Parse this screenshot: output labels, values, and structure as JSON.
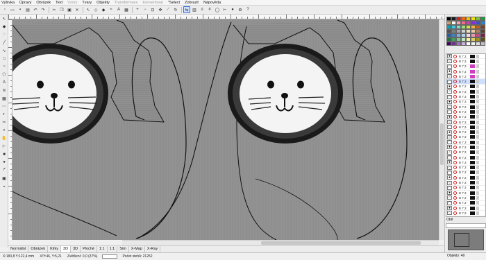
{
  "menu": [
    "Výšivka",
    "Úpravy",
    "Obrázek",
    "Text",
    "Vzory",
    "Tvary",
    "Objekty",
    "Transformace",
    "Konvertovat",
    "\"Select",
    "Zobrazit",
    "Nápověda"
  ],
  "menu_disabled": [
    false,
    false,
    false,
    false,
    true,
    false,
    false,
    true,
    true,
    false,
    false,
    false
  ],
  "toolbar_icons": [
    "new-icon",
    "open-icon",
    "save-icon",
    "print-icon",
    "undo-icon",
    "redo-icon",
    "cut-icon",
    "copy-icon",
    "paste-icon",
    "delete-icon",
    "select-icon",
    "shape-icon",
    "node-icon",
    "stitch-icon",
    "text-icon",
    "fill-icon",
    "zoom-in-icon",
    "zoom-out-icon",
    "zoom-fit-icon",
    "pan-icon",
    "pipette-icon",
    "rotate-icon",
    "mirror-icon",
    "group-icon",
    "align-icon",
    "grid-icon",
    "hoop-icon",
    "measure-icon",
    "color-icon",
    "settings-icon",
    "help-icon"
  ],
  "toolbar_active_index": 22,
  "left_tools": [
    "pointer-icon",
    "node-tool-icon",
    "lasso-icon",
    "line-tool-icon",
    "bezier-tool-icon",
    "rect-tool-icon",
    "ellipse-tool-icon",
    "polygon-tool-icon",
    "text-tool-icon",
    "satin-tool-icon",
    "fill-tool-icon",
    "running-stitch-icon",
    "applique-icon",
    "cut-tool-icon",
    "zoom-tool-icon",
    "hand-tool-icon",
    "measure-tool-icon",
    "stop-tool-icon",
    "color-tool-icon",
    "trim-tool-icon",
    "lock-tool-icon",
    "hide-tool-icon"
  ],
  "view_tabs": [
    "Normální",
    "Obrázek",
    "Klíky",
    "3D",
    "3D",
    "Ploché",
    "1:1",
    "1:1",
    "Sim",
    "X-Map",
    "X-Ray"
  ],
  "view_tab_selected": 3,
  "status": {
    "coords": "X:183,8 Y:122,4 mm",
    "size": "X/Y:46, Y:5,21",
    "zoom": "Zvětšení: 0,0 (37%)",
    "stitches": "Počet stehů: 21252",
    "object_count": "Objekty: 49"
  },
  "palette_colors": [
    "#000000",
    "#1a1a1a",
    "#e01b1b",
    "#f06a10",
    "#f0c400",
    "#f4e300",
    "#7cc242",
    "#1b9e3e",
    "#c8a070",
    "#ffffff",
    "#ff9fb0",
    "#f26d8d",
    "#d63cae",
    "#8a2be2",
    "#3a51c8",
    "#1c88d6",
    "#00a5b5",
    "#3ec5d8",
    "#7ad9c8",
    "#a0e070",
    "#d8e040",
    "#f0b040",
    "#c06020",
    "#804020",
    "#505050",
    "#808080",
    "#a8a8a8",
    "#d0d0d0",
    "#f0e0c0",
    "#e8c8a0",
    "#b08060",
    "#604030",
    "#2060a0",
    "#4080c0",
    "#80b0e0",
    "#b0d0f0",
    "#f8d8e0",
    "#e898b0",
    "#c05080",
    "#802040",
    "#207040",
    "#40a060",
    "#80c890",
    "#c0e8c0",
    "#f8f0a0",
    "#e0d060",
    "#a09020",
    "#605010",
    "#400060",
    "#703090",
    "#a070c0",
    "#d0b0e0",
    "#ffffff",
    "#f0f0f0",
    "#e0e0e0",
    "#c0c0c0"
  ],
  "object_list": [
    {
      "size": "B 7,3",
      "fill": "black",
      "hl": false
    },
    {
      "size": "B 7,3",
      "fill": "black",
      "hl": false
    },
    {
      "size": "B 7,3",
      "fill": "pink",
      "hl": false
    },
    {
      "size": "B 7,3",
      "fill": "pink",
      "hl": false
    },
    {
      "size": "B 7,3",
      "fill": "pink",
      "hl": false
    },
    {
      "size": "B 7,3",
      "fill": "black",
      "hl": true
    },
    {
      "size": "B 7,3",
      "fill": "black",
      "hl": false
    },
    {
      "size": "B 7,3",
      "fill": "black",
      "hl": false
    },
    {
      "size": "B 7,3",
      "fill": "black",
      "hl": false
    },
    {
      "size": "B 7,3",
      "fill": "black",
      "hl": false
    },
    {
      "size": "B 7,3",
      "fill": "black",
      "hl": false
    },
    {
      "size": "B 7,3",
      "fill": "black",
      "hl": false
    },
    {
      "size": "B 7,3",
      "fill": "black",
      "hl": false
    },
    {
      "size": "B 7,3",
      "fill": "black",
      "hl": false
    },
    {
      "size": "B 7,3",
      "fill": "black",
      "hl": false
    },
    {
      "size": "B 7,3",
      "fill": "black",
      "hl": false
    },
    {
      "size": "B 7,3",
      "fill": "black",
      "hl": false
    },
    {
      "size": "B 7,3",
      "fill": "black",
      "hl": false
    },
    {
      "size": "B 7,3",
      "fill": "black",
      "hl": false
    },
    {
      "size": "B 7,3",
      "fill": "black",
      "hl": false
    },
    {
      "size": "B 7,3",
      "fill": "black",
      "hl": false
    },
    {
      "size": "B 7,3",
      "fill": "black",
      "hl": false
    },
    {
      "size": "B 7,3",
      "fill": "black",
      "hl": false
    },
    {
      "size": "B 7,3",
      "fill": "black",
      "hl": false
    },
    {
      "size": "B 7,3",
      "fill": "black",
      "hl": false
    },
    {
      "size": "B 7,3",
      "fill": "black",
      "hl": false
    },
    {
      "size": "B 7,3",
      "fill": "black",
      "hl": false
    },
    {
      "size": "B 7,3",
      "fill": "black",
      "hl": false
    },
    {
      "size": "B 7,3",
      "fill": "black",
      "hl": false
    },
    {
      "size": "B 7,3",
      "fill": "black",
      "hl": false
    },
    {
      "size": "B 7,3",
      "fill": "black",
      "hl": false
    },
    {
      "size": "B 7,3",
      "fill": "black",
      "hl": false
    }
  ],
  "object_panel_label": "Obě"
}
